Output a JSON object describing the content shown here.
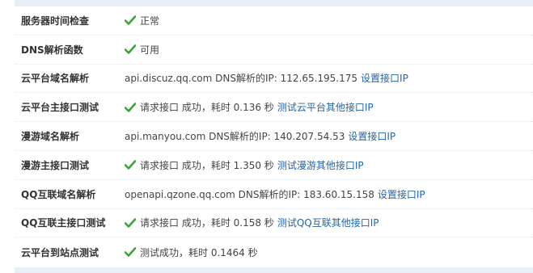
{
  "colors": {
    "accent_link": "#2366a8",
    "ok_green": "#3aa537",
    "strip": "#e8eff7"
  },
  "rows": [
    {
      "label": "服务器时间检查",
      "status_icon": "check-icon",
      "text": "正常"
    },
    {
      "label": "DNS解析函数",
      "status_icon": "check-icon",
      "text": "可用"
    },
    {
      "label": "云平台域名解析",
      "text": "api.discuz.qq.com DNS解析的IP:  112.65.195.175",
      "link": "设置接口IP"
    },
    {
      "label": "云平台主接口测试",
      "status_icon": "check-icon",
      "text": "请求接口 成功，耗时 0.136 秒",
      "link": "测试云平台其他接口IP"
    },
    {
      "label": "漫游域名解析",
      "text": "api.manyou.com DNS解析的IP:  140.207.54.53",
      "link": "设置接口IP"
    },
    {
      "label": "漫游主接口测试",
      "status_icon": "check-icon",
      "text": "请求接口 成功，耗时 1.350 秒",
      "link": "测试漫游其他接口IP"
    },
    {
      "label": "QQ互联域名解析",
      "text": "openapi.qzone.qq.com DNS解析的IP:  183.60.15.158",
      "link": "设置接口IP"
    },
    {
      "label": "QQ互联主接口测试",
      "status_icon": "check-icon",
      "text": "请求接口 成功，耗时 0.158 秒",
      "link": "测试QQ互联其他接口IP"
    },
    {
      "label": "云平台到站点测试",
      "status_icon": "check-icon",
      "text": "测试成功，耗时 0.1464 秒"
    }
  ]
}
